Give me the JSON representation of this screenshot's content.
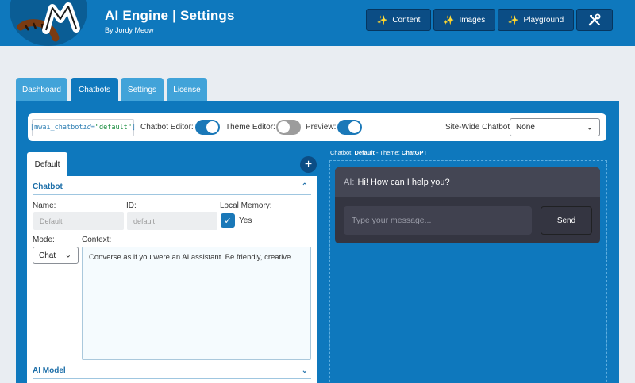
{
  "header": {
    "title": "AI Engine | Settings",
    "subtitle": "By Jordy Meow",
    "buttons": [
      {
        "label": "Content",
        "icon": "sparkle-wand-icon"
      },
      {
        "label": "Images",
        "icon": "sparkle-wand-icon"
      },
      {
        "label": "Playground",
        "icon": "sparkle-wand-icon"
      }
    ],
    "tools_icon": "tools-icon"
  },
  "tabs": [
    {
      "label": "Dashboard",
      "active": false
    },
    {
      "label": "Chatbots",
      "active": true
    },
    {
      "label": "Settings",
      "active": false
    },
    {
      "label": "License",
      "active": false
    }
  ],
  "toolbar": {
    "shortcode_open": "[mwai_chatbot ",
    "shortcode_attr": "id=",
    "shortcode_value": "\"default\"",
    "shortcode_close": "]",
    "chatbot_editor_label": "Chatbot Editor:",
    "chatbot_editor_on": true,
    "theme_editor_label": "Theme Editor:",
    "theme_editor_on": false,
    "preview_label": "Preview:",
    "preview_on": true,
    "sitewide_label": "Site-Wide Chatbot:",
    "sitewide_value": "None"
  },
  "editor": {
    "tab_label": "Default",
    "add_symbol": "+",
    "chatbot_section": "Chatbot",
    "name_label": "Name:",
    "name_placeholder": "Default",
    "id_label": "ID:",
    "id_placeholder": "default",
    "local_memory_label": "Local Memory:",
    "local_memory_value": "Yes",
    "mode_label": "Mode:",
    "mode_value": "Chat",
    "context_label": "Context:",
    "context_value": "Converse as if you were an AI assistant. Be friendly, creative.",
    "ai_model_section": "AI Model"
  },
  "preview": {
    "chatbot_prefix": "Chatbot: ",
    "chatbot_name": "Default",
    "theme_prefix": " - Theme: ",
    "theme_name": "ChatGPT",
    "reply_who": "AI:",
    "reply_text": "Hi! How can I help you?",
    "input_placeholder": "Type your message...",
    "send_label": "Send"
  },
  "colors": {
    "brand_blue": "#0e78bd",
    "dark_blue": "#0b4d85",
    "tab_inactive": "#41a3d9",
    "chat_bg": "#343541"
  }
}
